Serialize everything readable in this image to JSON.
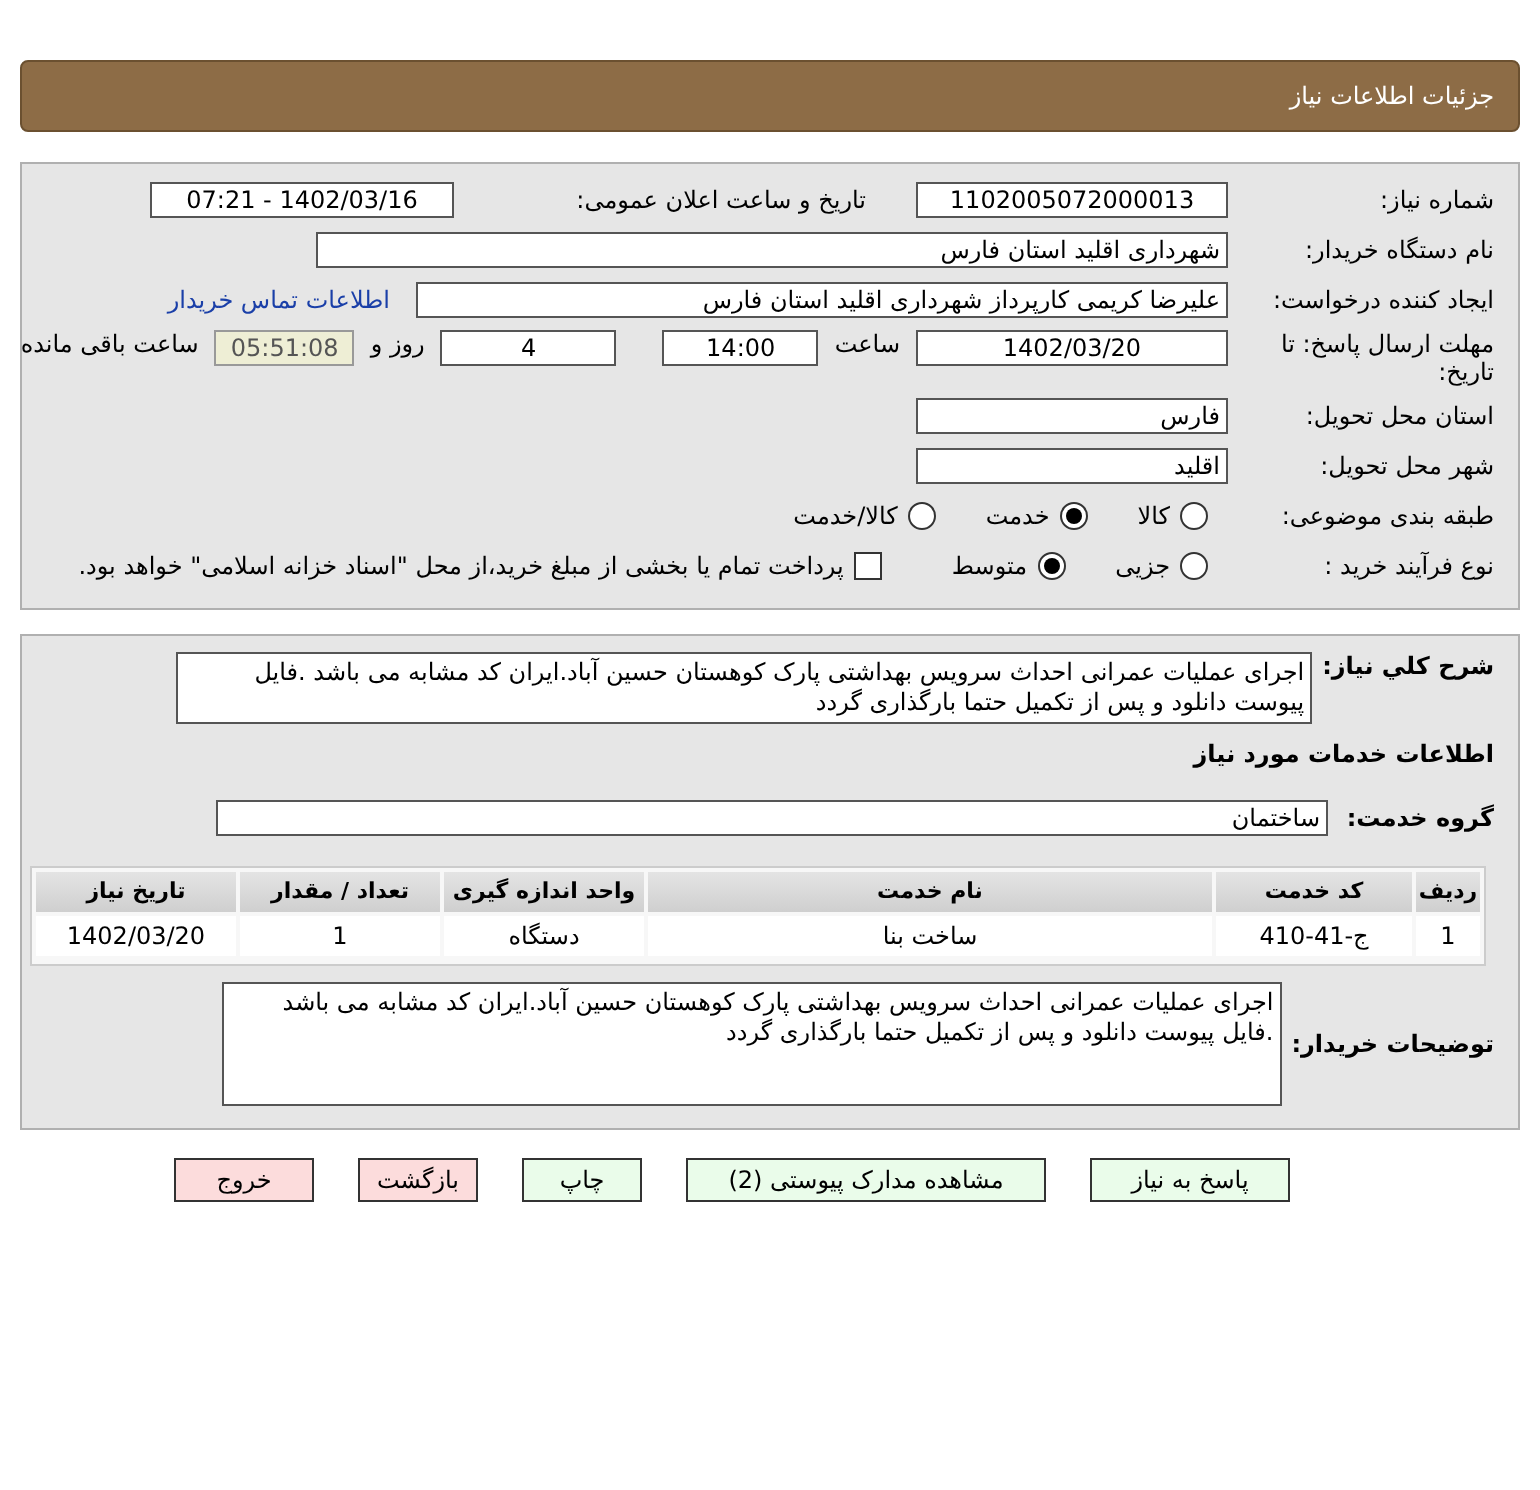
{
  "header": {
    "title": "جزئیات اطلاعات نیاز"
  },
  "details": {
    "need_number": {
      "label": "شماره نیاز:",
      "value": "1102005072000013"
    },
    "announce": {
      "label": "تاریخ و ساعت اعلان عمومی:",
      "value": "1402/03/16 - 07:21"
    },
    "buyer": {
      "label": "نام دستگاه خریدار:",
      "value": "شهرداری اقلید استان فارس"
    },
    "requester": {
      "label": "ایجاد کننده درخواست:",
      "value": "علیرضا کریمی  کارپرداز شهرداری اقلید استان فارس",
      "link": "اطلاعات تماس خریدار"
    },
    "deadline": {
      "label": "مهلت ارسال پاسخ: تا تاریخ:",
      "date": "1402/03/20",
      "time_label": "ساعت",
      "time": "14:00",
      "days": "4",
      "days_label": "روز و",
      "remaining": "05:51:08",
      "remaining_label": "ساعت باقی مانده"
    },
    "province": {
      "label": "استان محل تحویل:",
      "value": "فارس"
    },
    "city": {
      "label": "شهر محل تحویل:",
      "value": "اقلید"
    },
    "category": {
      "label": "طبقه بندی موضوعی:",
      "options": [
        {
          "label": "کالا",
          "selected": false
        },
        {
          "label": "خدمت",
          "selected": true
        },
        {
          "label": "کالا/خدمت",
          "selected": false
        }
      ]
    },
    "purchase_type": {
      "label": "نوع فرآیند خرید :",
      "options": [
        {
          "label": "جزیی",
          "selected": false
        },
        {
          "label": "متوسط",
          "selected": true
        }
      ],
      "payment": {
        "checked": false,
        "label": "پرداخت تمام یا بخشی از مبلغ خرید،از محل \"اسناد خزانه اسلامی\" خواهد بود."
      }
    }
  },
  "services": {
    "description": {
      "label": "شرح کلي نياز:",
      "value": "اجرای عملیات عمرانی احداث سرویس بهداشتی پارک کوهستان حسین آباد.ایران کد مشابه می باشد .فایل پیوست دانلود و پس از تکمیل حتما بارگذاری گردد"
    },
    "section_title": "اطلاعات خدمات مورد نیاز",
    "group": {
      "label": "گروه خدمت:",
      "value": "ساختمان"
    },
    "table": {
      "columns": [
        "ردیف",
        "کد خدمت",
        "نام خدمت",
        "واحد اندازه گیری",
        "تعداد / مقدار",
        "تاریخ نیاز"
      ],
      "rows": [
        [
          "1",
          "ج-41-410",
          "ساخت بنا",
          "دستگاه",
          "1",
          "1402/03/20"
        ]
      ]
    },
    "notes": {
      "label": "توضیحات خریدار:",
      "value": "اجرای عملیات عمرانی احداث سرویس بهداشتی پارک کوهستان حسین آباد.ایران کد مشابه می باشد .فایل پیوست دانلود و پس از تکمیل حتما بارگذاری گردد"
    }
  },
  "buttons": [
    {
      "label": "پاسخ به نیاز",
      "kind": "action"
    },
    {
      "label": "مشاهده مدارک پیوستی (2)",
      "kind": "action"
    },
    {
      "label": "چاپ",
      "kind": "action"
    },
    {
      "label": "بازگشت",
      "kind": "exit"
    },
    {
      "label": "خروج",
      "kind": "exit"
    }
  ]
}
